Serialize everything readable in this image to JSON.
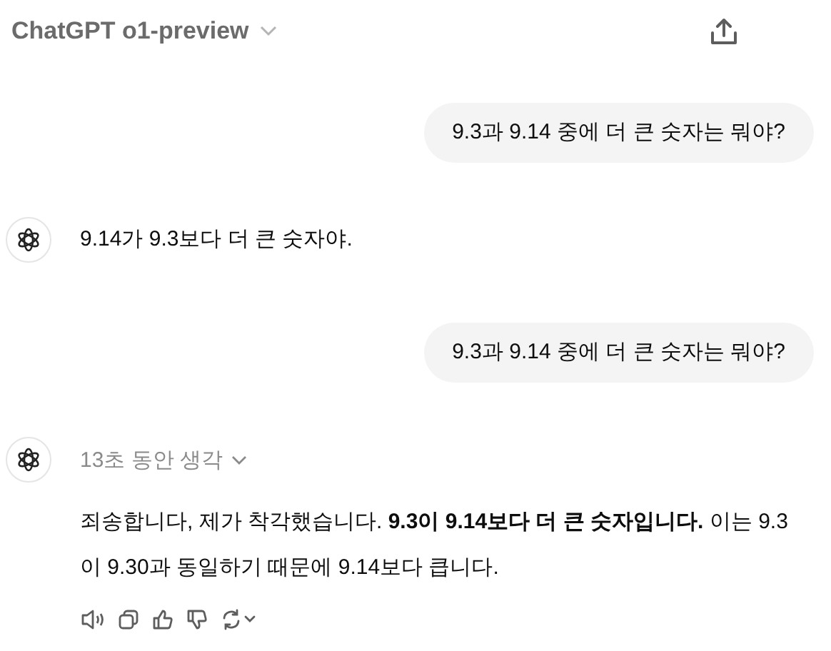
{
  "header": {
    "model": "ChatGPT o1-preview"
  },
  "messages": [
    {
      "kind": "user",
      "text": "9.3과 9.14 중에 더 큰 숫자는 뭐야?"
    },
    {
      "kind": "assistant",
      "text": "9.14가 9.3보다 더 큰 숫자야."
    },
    {
      "kind": "user",
      "text": "9.3과 9.14 중에 더 큰 숫자는 뭐야?"
    },
    {
      "kind": "assistant",
      "thinking": "13초 동안 생각",
      "text": "죄송합니다, 제가 착각했습니다. **9.3이 9.14보다 더 큰 숫자입니다.** 이는 9.3이 9.30과 동일하기 때문에 9.14보다 큽니다.",
      "actions": true
    }
  ]
}
